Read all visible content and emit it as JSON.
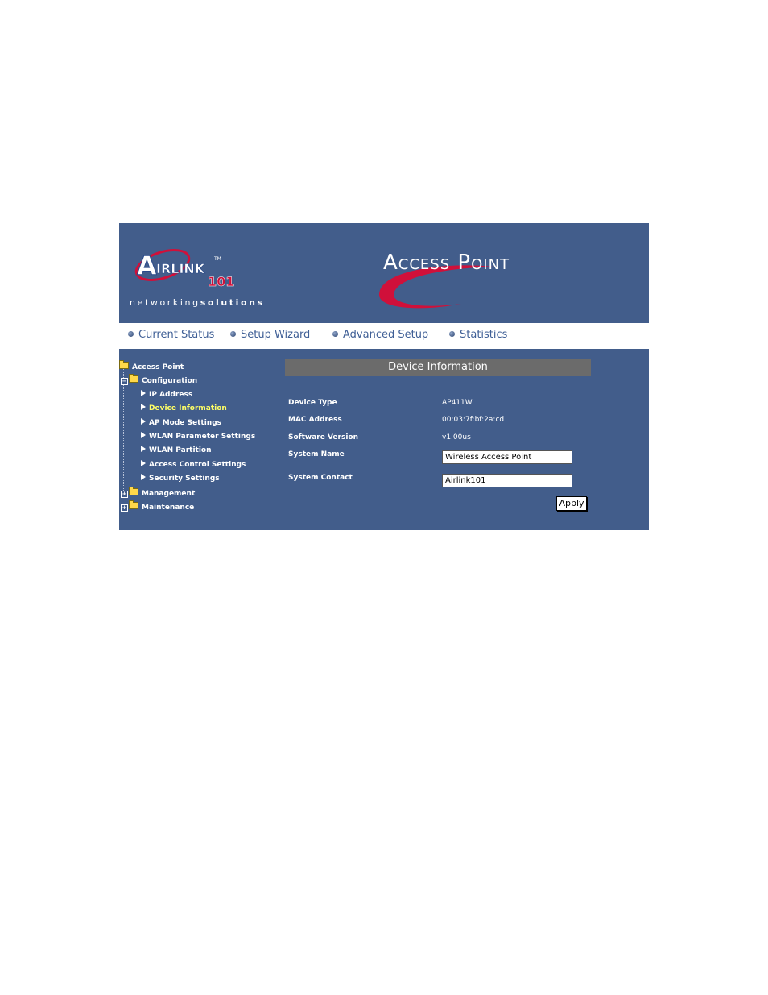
{
  "header": {
    "logo_text": "AirLink 101",
    "logo_tagline_part1": "networking",
    "logo_tagline_part2": "solutions",
    "title": "Access Point"
  },
  "nav": [
    {
      "label": "Current Status"
    },
    {
      "label": "Setup Wizard"
    },
    {
      "label": "Advanced Setup"
    },
    {
      "label": "Statistics"
    }
  ],
  "tree": {
    "root": "Access Point",
    "configuration": "Configuration",
    "items": [
      {
        "label": "IP Address"
      },
      {
        "label": "Device Information"
      },
      {
        "label": "AP Mode Settings"
      },
      {
        "label": "WLAN Parameter Settings"
      },
      {
        "label": "WLAN Partition"
      },
      {
        "label": "Access Control Settings"
      },
      {
        "label": "Security Settings"
      }
    ],
    "management": "Management",
    "maintenance": "Maintenance",
    "active_index": 1
  },
  "content": {
    "section_title": "Device Information",
    "device_type_label": "Device Type",
    "device_type_value": "AP411W",
    "mac_label": "MAC Address",
    "mac_value": "00:03:7f:bf:2a:cd",
    "software_label": "Software Version",
    "software_value": "v1.00us",
    "system_name_label": "System Name",
    "system_name_value": "Wireless Access Point",
    "system_contact_label": "System Contact",
    "system_contact_value": "Airlink101",
    "apply_label": "Apply"
  },
  "colors": {
    "panel_blue": "#425d8b",
    "section_bar": "#6b6b6b",
    "nav_text": "#3f5f96",
    "logo_red": "#d0103a",
    "active_item": "#ffff66"
  },
  "icons": [
    "folder-icon",
    "expand-icon",
    "arrow-icon",
    "nav-bullet-icon"
  ]
}
